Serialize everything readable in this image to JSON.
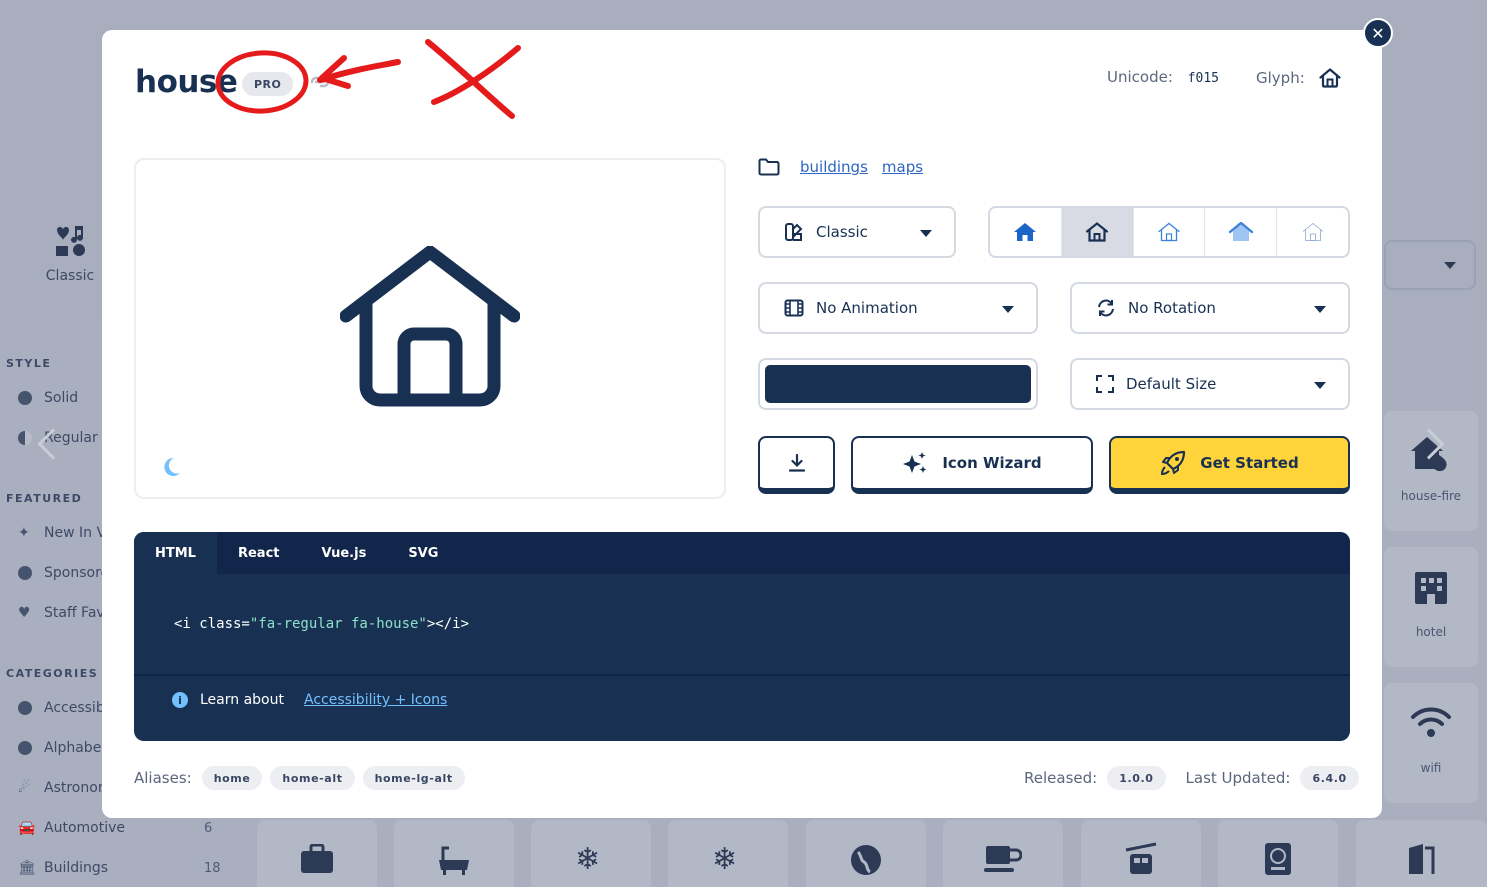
{
  "background": {
    "style_button": {
      "label": "Classic"
    },
    "sidebar": {
      "style_heading": "STYLE",
      "style_items": [
        {
          "label": "Solid"
        },
        {
          "label": "Regular"
        }
      ],
      "featured_heading": "FEATURED",
      "featured_items": [
        {
          "label": "New In V"
        },
        {
          "label": "Sponsore"
        },
        {
          "label": "Staff Fav"
        }
      ],
      "categories_heading": "CATEGORIES",
      "category_items": [
        {
          "label": "Accessib",
          "count": ""
        },
        {
          "label": "Alphabe",
          "count": ""
        },
        {
          "label": "Astronor",
          "count": ""
        },
        {
          "label": "Automotive",
          "count": "6"
        },
        {
          "label": "Buildings",
          "count": "18"
        }
      ]
    },
    "grid_cards": [
      {
        "label": "house-fire"
      },
      {
        "label": "hotel"
      },
      {
        "label": "wifi"
      }
    ]
  },
  "modal": {
    "icon_name": "house",
    "pro_badge": "PRO",
    "unicode_label": "Unicode:",
    "unicode_value": "f015",
    "glyph_label": "Glyph:",
    "categories": [
      "buildings",
      "maps"
    ],
    "family_select": "Classic",
    "animation_select": "No Animation",
    "rotation_select": "No Rotation",
    "size_select": "Default Size",
    "color_value": "#183153",
    "style_options": [
      {
        "name": "solid",
        "color": "#1c64c8"
      },
      {
        "name": "regular",
        "color": "#183153"
      },
      {
        "name": "light",
        "color": "#3b82d8"
      },
      {
        "name": "duotone",
        "color": "#3b82d8"
      },
      {
        "name": "thin",
        "color": "#8fa6c8"
      }
    ],
    "buttons": {
      "icon_wizard": "Icon Wizard",
      "get_started": "Get Started"
    },
    "code": {
      "tabs": [
        "HTML",
        "React",
        "Vue.js",
        "SVG"
      ],
      "active_tab": "HTML",
      "snippet_prefix": "<i class=",
      "snippet_value": "\"fa-regular fa-house\"",
      "snippet_suffix": "></i>",
      "learn_text": "Learn about",
      "learn_link": "Accessibility + Icons"
    },
    "footer": {
      "aliases_label": "Aliases:",
      "aliases": [
        "home",
        "home-alt",
        "home-lg-alt"
      ],
      "released_label": "Released:",
      "released_value": "1.0.0",
      "updated_label": "Last Updated:",
      "updated_value": "6.4.0"
    }
  },
  "colors": {
    "navy": "#183153",
    "yellow": "#ffd43b",
    "annotation_red": "#e51b1b"
  }
}
